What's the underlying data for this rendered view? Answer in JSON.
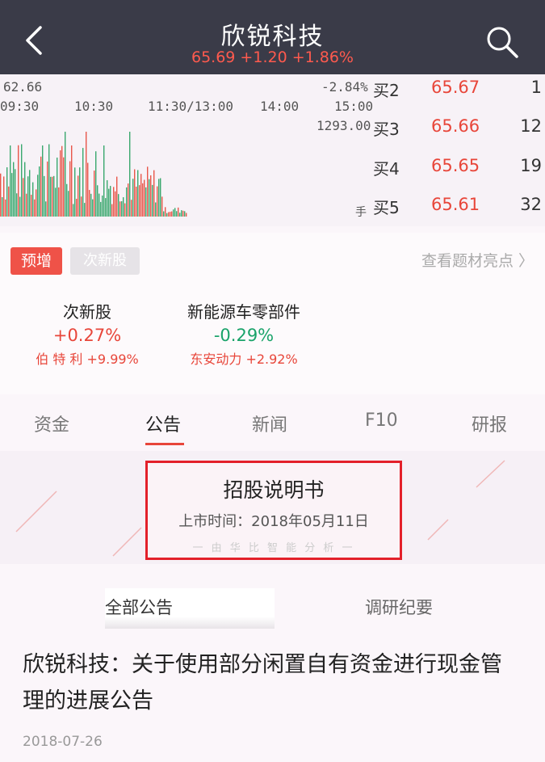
{
  "header": {
    "title": "欣锐科技",
    "quote": "65.69 +1.20 +1.86%",
    "colors": {
      "background": "#3a3b48",
      "up": "#ff5a4e"
    }
  },
  "chart": {
    "price_label": "62.66",
    "pct_label": "-2.84%",
    "volume_label": "1293.00",
    "unit_label": "手",
    "times": [
      "09:30",
      "10:30",
      "11:30/13:00",
      "14:00",
      "15:00"
    ]
  },
  "order_book": [
    {
      "label": "买2",
      "price": "65.67",
      "vol": "1"
    },
    {
      "label": "买3",
      "price": "65.66",
      "vol": "12"
    },
    {
      "label": "买4",
      "price": "65.65",
      "vol": "19"
    },
    {
      "label": "买5",
      "price": "65.61",
      "vol": "32"
    }
  ],
  "tags": {
    "forecast": "预增",
    "new_stock": "次新股",
    "view_highlights": "查看题材亮点 〉"
  },
  "concepts": [
    {
      "name": "次新股",
      "change": "+0.27%",
      "stock": "伯 特 利",
      "stock_change": "+9.99%"
    },
    {
      "name": "新能源车零部件",
      "change": "-0.29%",
      "stock": "东安动力",
      "stock_change": "+2.92%"
    }
  ],
  "tabs": [
    "资金",
    "公告",
    "新闻",
    "F10",
    "研报"
  ],
  "banner": {
    "title": "招股说明书",
    "date": "上市时间：2018年05月11日",
    "footer": "一 由 华 比 智 能 分 析 一"
  },
  "subtabs": {
    "all": "全部公告",
    "research": "调研纪要"
  },
  "article": {
    "title": "欣锐科技：关于使用部分闲置自有资金进行现金管理的进展公告",
    "date": "2018-07-26"
  }
}
